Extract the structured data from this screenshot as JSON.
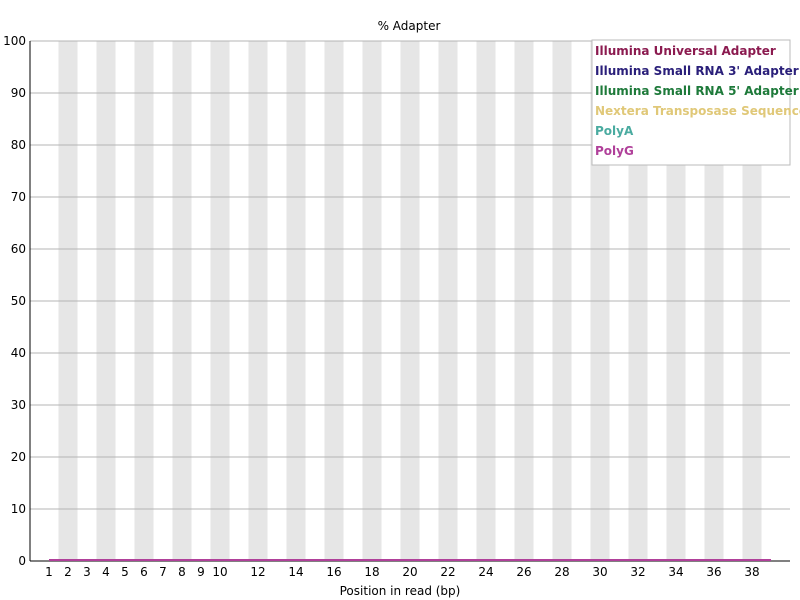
{
  "chart_data": {
    "type": "line",
    "title": "% Adapter",
    "xlabel": "Position in read (bp)",
    "ylabel": "",
    "x": [
      1,
      2,
      3,
      4,
      5,
      6,
      7,
      8,
      9,
      10,
      11,
      12,
      13,
      14,
      15,
      16,
      17,
      18,
      19,
      20,
      21,
      22,
      23,
      24,
      25,
      26,
      27,
      28,
      29,
      30,
      31,
      32,
      33,
      34,
      35,
      36,
      37,
      38,
      39
    ],
    "x_tick_labels": [
      "1",
      "2",
      "3",
      "4",
      "5",
      "6",
      "7",
      "8",
      "9",
      "10",
      "12",
      "14",
      "16",
      "18",
      "20",
      "22",
      "24",
      "26",
      "28",
      "30",
      "32",
      "34",
      "36",
      "38"
    ],
    "x_tick_positions": [
      1,
      2,
      3,
      4,
      5,
      6,
      7,
      8,
      9,
      10,
      12,
      14,
      16,
      18,
      20,
      22,
      24,
      26,
      28,
      30,
      32,
      34,
      36,
      38
    ],
    "y_ticks": [
      "0",
      "10",
      "20",
      "30",
      "40",
      "50",
      "60",
      "70",
      "80",
      "90",
      "100"
    ],
    "ylim": [
      0,
      100
    ],
    "grid": true,
    "legend_position": "top-right",
    "series": [
      {
        "name": "Illumina Universal Adapter",
        "color": "#8b1a4f",
        "values": [
          0,
          0,
          0,
          0,
          0,
          0,
          0,
          0,
          0,
          0,
          0,
          0,
          0,
          0,
          0,
          0,
          0,
          0,
          0,
          0,
          0,
          0,
          0,
          0,
          0,
          0,
          0,
          0,
          0,
          0,
          0,
          0,
          0,
          0,
          0,
          0,
          0,
          0,
          0
        ]
      },
      {
        "name": "Illumina Small RNA 3' Adapter",
        "color": "#2a1f7a",
        "values": [
          0,
          0,
          0,
          0,
          0,
          0,
          0,
          0,
          0,
          0,
          0,
          0,
          0,
          0,
          0,
          0,
          0,
          0,
          0,
          0,
          0,
          0,
          0,
          0,
          0,
          0,
          0,
          0,
          0,
          0,
          0,
          0,
          0,
          0,
          0,
          0,
          0,
          0,
          0
        ]
      },
      {
        "name": "Illumina Small RNA 5' Adapter",
        "color": "#1e7a3a",
        "values": [
          0,
          0,
          0,
          0,
          0,
          0,
          0,
          0,
          0,
          0,
          0,
          0,
          0,
          0,
          0,
          0,
          0,
          0,
          0,
          0,
          0,
          0,
          0,
          0,
          0,
          0,
          0,
          0,
          0,
          0,
          0,
          0,
          0,
          0,
          0,
          0,
          0,
          0,
          0
        ]
      },
      {
        "name": "Nextera Transposase Sequence",
        "color": "#e0c878",
        "values": [
          0,
          0,
          0,
          0,
          0,
          0,
          0,
          0,
          0,
          0,
          0,
          0,
          0,
          0,
          0,
          0,
          0,
          0,
          0,
          0,
          0,
          0,
          0,
          0,
          0,
          0,
          0,
          0,
          0,
          0,
          0,
          0,
          0,
          0,
          0,
          0,
          0,
          0,
          0
        ]
      },
      {
        "name": "PolyA",
        "color": "#4aaba0",
        "values": [
          0,
          0,
          0,
          0,
          0,
          0,
          0,
          0,
          0,
          0,
          0,
          0,
          0,
          0,
          0,
          0,
          0,
          0,
          0,
          0,
          0,
          0,
          0,
          0,
          0,
          0,
          0,
          0,
          0,
          0,
          0,
          0,
          0,
          0,
          0,
          0,
          0,
          0,
          0
        ]
      },
      {
        "name": "PolyG",
        "color": "#b0409a",
        "values": [
          0,
          0,
          0,
          0,
          0,
          0,
          0,
          0,
          0,
          0,
          0,
          0,
          0,
          0,
          0,
          0,
          0,
          0,
          0,
          0,
          0,
          0,
          0,
          0,
          0,
          0,
          0,
          0,
          0,
          0,
          0,
          0,
          0,
          0,
          0,
          0,
          0,
          0,
          0
        ]
      }
    ]
  }
}
